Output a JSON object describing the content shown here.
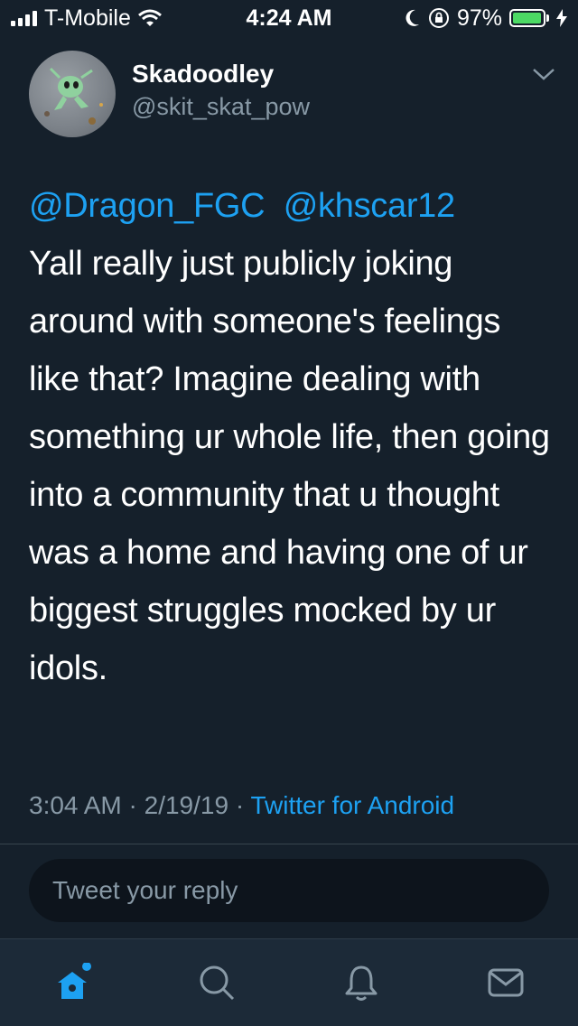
{
  "status_bar": {
    "carrier": "T-Mobile",
    "time": "4:24 AM",
    "battery_percent_label": "97%",
    "battery_level": 0.97,
    "colors": {
      "battery": "#4cd964"
    }
  },
  "tweet": {
    "display_name": "Skadoodley",
    "handle": "@skit_skat_pow",
    "mentions": [
      "@Dragon_FGC",
      "@khscar12"
    ],
    "body": "Yall really just publicly joking around with someone's feelings like that? Imagine dealing with something ur whole life, then going into a community that u thought was a home and having one of ur biggest struggles mocked by ur idols.",
    "timestamp": "3:04 AM",
    "date": "2/19/19",
    "separator": "·",
    "source": "Twitter for Android"
  },
  "reply": {
    "placeholder": "Tweet your reply"
  },
  "tab_bar": {
    "tabs": [
      {
        "icon": "home-icon",
        "active": true
      },
      {
        "icon": "search-icon",
        "active": false
      },
      {
        "icon": "bell-icon",
        "active": false
      },
      {
        "icon": "mail-icon",
        "active": false
      }
    ]
  },
  "colors": {
    "background": "#15202b",
    "accent": "#1da1f2",
    "secondary_text": "#8899a6"
  }
}
